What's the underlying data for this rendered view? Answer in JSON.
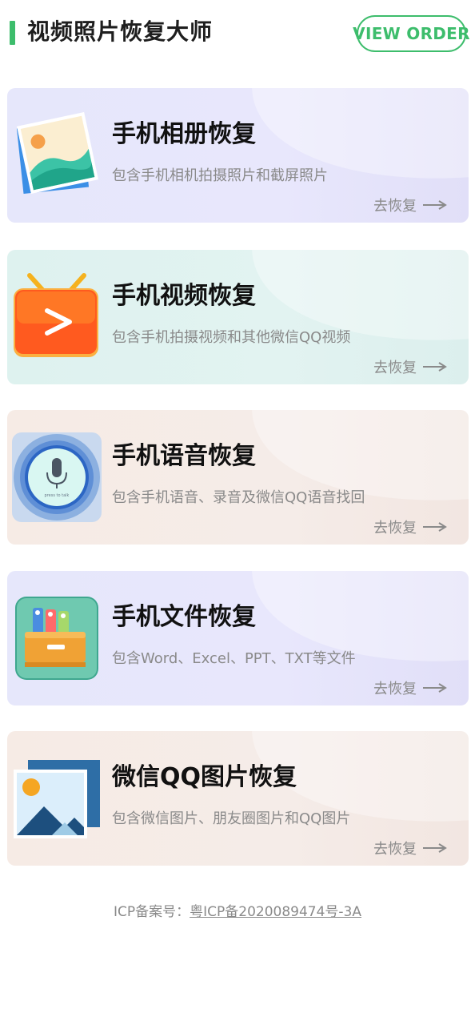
{
  "header": {
    "title": "视频照片恢复大师",
    "view_order": "VIEW ORDER",
    "accent_color": "#3dbd6c"
  },
  "cards": [
    {
      "title": "手机相册恢复",
      "desc": "包含手机相机拍摄照片和截屏照片",
      "action": "去恢复",
      "icon": "photo-album-icon"
    },
    {
      "title": "手机视频恢复",
      "desc": "包含手机拍摄视频和其他微信QQ视频",
      "action": "去恢复",
      "icon": "video-tv-icon"
    },
    {
      "title": "手机语音恢复",
      "desc": "包含手机语音、录音及微信QQ语音找回",
      "action": "去恢复",
      "icon": "microphone-icon",
      "icon_caption": "press to talk"
    },
    {
      "title": "手机文件恢复",
      "desc": "包含Word、Excel、PPT、TXT等文件",
      "action": "去恢复",
      "icon": "file-box-icon"
    },
    {
      "title": "微信QQ图片恢复",
      "desc": "包含微信图片、朋友圈图片和QQ图片",
      "action": "去恢复",
      "icon": "image-icon"
    }
  ],
  "footer": {
    "icp_label": "ICP备案号：",
    "icp_number": "粤ICP备2020089474号-3A"
  }
}
